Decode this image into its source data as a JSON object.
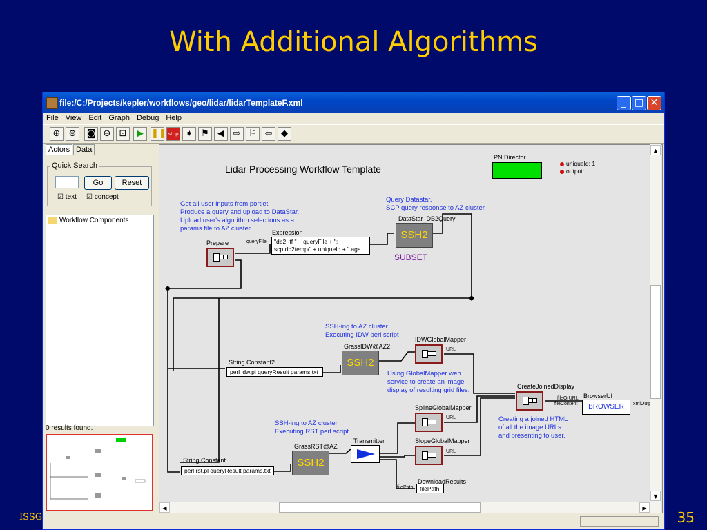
{
  "slide": {
    "title": "With Additional Algorithms",
    "page_number": "35",
    "footer": "ISSG"
  },
  "window": {
    "title": "file:/C:/Projects/kepler/workflows/geo/lidar/lidarTemplateF.xml",
    "controls": {
      "minimize": "_",
      "maximize": "□",
      "close": "✕"
    },
    "menu": [
      "File",
      "View",
      "Edit",
      "Graph",
      "Debug",
      "Help"
    ],
    "toolbar_icons": [
      "zoom-in",
      "zoom-reset",
      "zoom-fit",
      "zoom-out",
      "fit-page",
      "run",
      "pause",
      "stop",
      "step",
      "arrow-right-filled",
      "flag",
      "arrow-left-filled",
      "arrow-right-outline",
      "flag-outline",
      "arrow-left-outline",
      "diamond"
    ]
  },
  "left_panel": {
    "tabs": [
      "Actors",
      "Data"
    ],
    "quick_search": {
      "legend": "Quick Search",
      "input_value": "",
      "go_label": "Go",
      "reset_label": "Reset",
      "text_checkbox": "text",
      "concept_checkbox": "concept"
    },
    "tree_root": "Workflow Components",
    "results_text": "0 results found."
  },
  "workflow": {
    "title": "Lidar Processing Workflow Template",
    "director": "PN Director",
    "params": [
      "uniqueId: 1",
      "output:"
    ],
    "note1": "Get all user inputs from portlet.\nProduce a query and upload to DataStar.\nUpload user's algorithm selections as a\nparams file to AZ cluster.",
    "prepare": "Prepare",
    "queryfile_port": "queryFile",
    "expression_label": "Expression",
    "expression_value": "\"db2 -tf \" + queryFile + \";\nscp db2temp/\" + uniqueId + \" aga...",
    "note2": "Query Datastar.\nSCP query response to AZ cluster",
    "datastar_label": "DataStar_DB2Query",
    "ssh_text": "SSH2",
    "subset": "SUBSET",
    "note3": "SSH-ing to AZ cluster.\nExecuting IDW perl script",
    "grassidw": "GrassIDW@AZ2",
    "idwmapper": "IDWGlobalMapper",
    "url": "URL",
    "string_const2": "String Constant2",
    "const2_value": "perl idw.pl queryResult params.txt",
    "note4": "Using GlobalMapper web\nservice to create an image\ndisplay of resulting grid files.",
    "createjoined": "CreateJoinedDisplay",
    "fileorurl": "fileOrURL",
    "filecontent": "fileContent",
    "browserui": "BrowserUI",
    "browser": "BROWSER",
    "xmloutput": "xmlOutp",
    "note5": "Creating a joined HTML\nof all the image URLs\nand presenting to user.",
    "splinemapper": "SplineGlobalMapper",
    "slopemapper": "SlopeGlobalMapper",
    "note6": "SSH-ing to AZ cluster.\nExecuting RST perl script",
    "grassrst": "GrassRST@AZ",
    "transmitter": "Transmitter",
    "string_const": "String Constant",
    "const_value": "perl rst.pl queryResult params.txt",
    "download": "DownloadResults",
    "filepath": "filePath"
  }
}
